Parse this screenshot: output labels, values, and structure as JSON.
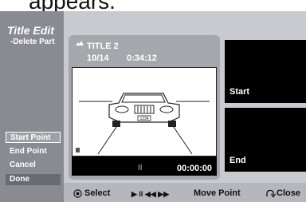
{
  "heading": "appears.",
  "sidebar": {
    "title": "Title Edit",
    "subtitle": "-Delete Part",
    "buttons": [
      "Start Point",
      "End Point",
      "Cancel",
      "Done"
    ]
  },
  "panel": {
    "title": "TITLE 2",
    "date": "10/14",
    "time": "0:34:12",
    "counter": "00:00:00",
    "car_plate": "1234"
  },
  "thumbs": {
    "start": "Start",
    "end": "End"
  },
  "bottom": {
    "select": "Select",
    "play_controls": "▶ II ◀◀ ▶▶",
    "move_point": "Move Point",
    "close": "Close"
  }
}
